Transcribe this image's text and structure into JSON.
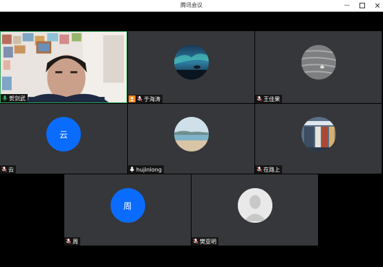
{
  "window": {
    "title": "腾讯会议"
  },
  "controls": {
    "minimize": "—",
    "close": "✕"
  },
  "participants": [
    {
      "name": "贺剑武",
      "kind": "video",
      "mic": "active"
    },
    {
      "name": "于海涛",
      "kind": "photo",
      "mic": "muted",
      "badge": "host"
    },
    {
      "name": "王佳果",
      "kind": "photo",
      "mic": "muted"
    },
    {
      "name": "云",
      "kind": "letter",
      "letter": "云",
      "mic": "muted"
    },
    {
      "name": "hujinlong",
      "kind": "photo",
      "mic": "on"
    },
    {
      "name": "在路上",
      "kind": "photo",
      "mic": "muted"
    },
    {
      "name": "周",
      "kind": "letter",
      "letter": "周",
      "mic": "muted"
    },
    {
      "name": "樊亚明",
      "kind": "default",
      "mic": "muted"
    }
  ],
  "colors": {
    "avatar_blue": "#0a6cff",
    "tile_bg": "#36373a",
    "active_border": "#2fa35a",
    "host_badge": "#f58a1f"
  },
  "icons": [
    "mic-muted-icon",
    "mic-on-icon",
    "mic-active-icon",
    "host-icon",
    "minimize-icon",
    "maximize-icon",
    "close-icon"
  ]
}
